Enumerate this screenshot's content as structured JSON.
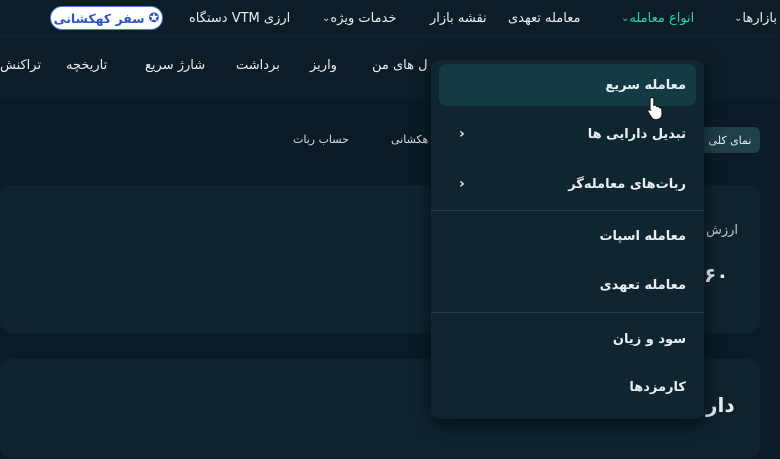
{
  "topnav": {
    "markets": "بازارها",
    "trade_types": "انواع معامله",
    "futures": "معامله تعهدی",
    "market_map": "نقشه بازار",
    "special_services": "خدمات ویژه",
    "vtm": "دستگاه VTM ارزی",
    "galaxy_trip": "سفر کهکشانی"
  },
  "subnav": {
    "transactions": "تراکنش",
    "history": "تاریخچه",
    "quick_charge": "شارژ سریع",
    "withdraw": "برداشت",
    "deposit": "واریز",
    "my_assets": "ل های من"
  },
  "tabs": {
    "overview": "نمای کلی",
    "galaxy": "هکشانی",
    "bot_account": "حساب ربات"
  },
  "cards": {
    "value_label": "ارزش",
    "value_number": "۶۰",
    "assets_label": "دار"
  },
  "dropdown": {
    "items": [
      {
        "label": "معامله سریع"
      },
      {
        "label": "تبدیل دارایی ها"
      },
      {
        "label": "ربات‌های معامله‌گر"
      },
      {
        "label": "معامله اسپات"
      },
      {
        "label": "معامله تعهدی"
      },
      {
        "label": "سود و زیان"
      },
      {
        "label": "کارمزدها"
      }
    ]
  }
}
